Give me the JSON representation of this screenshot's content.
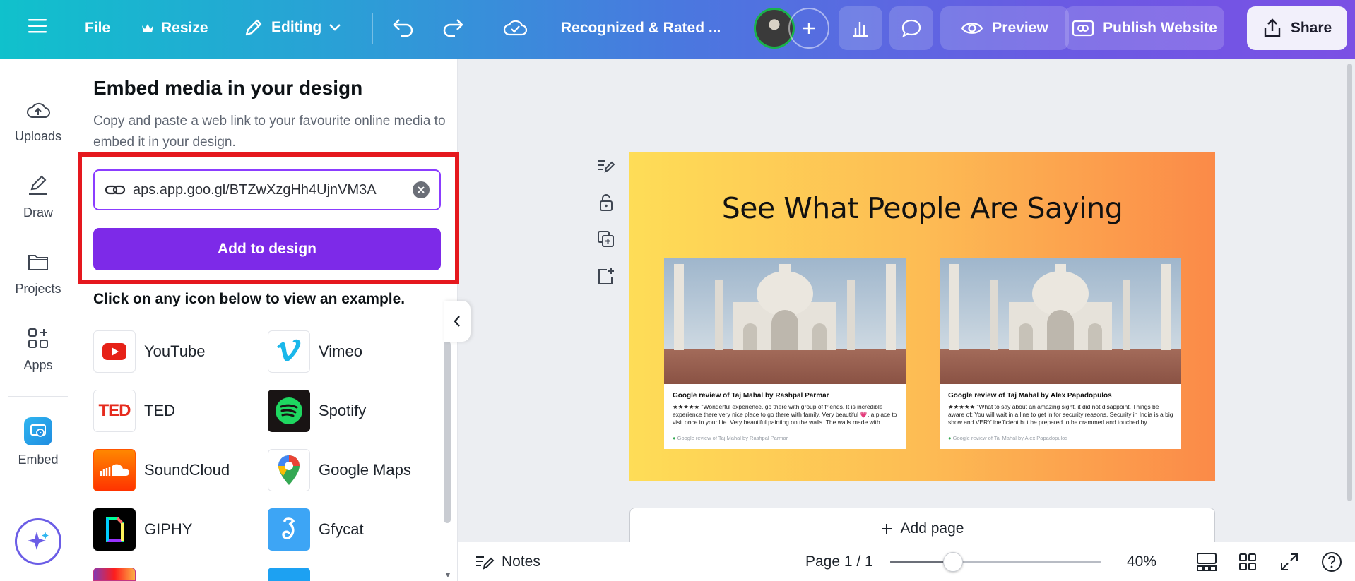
{
  "topbar": {
    "file_label": "File",
    "resize_label": "Resize",
    "editing_label": "Editing",
    "doc_title": "Recognized & Rated ...",
    "preview_label": "Preview",
    "publish_label": "Publish Website",
    "share_label": "Share",
    "gradient_colors": [
      "#10c1cc",
      "#4a78df",
      "#7b50e4"
    ]
  },
  "rail": {
    "items": [
      {
        "label": "Uploads",
        "icon": "cloud-upload-icon"
      },
      {
        "label": "Draw",
        "icon": "draw-pen-icon"
      },
      {
        "label": "Projects",
        "icon": "folder-icon"
      },
      {
        "label": "Apps",
        "icon": "apps-grid-icon"
      },
      {
        "label": "Embed",
        "icon": "embed-icon"
      }
    ]
  },
  "panel": {
    "title": "Embed media in your design",
    "description": "Copy and paste a web link to your favourite online media to embed it in your design.",
    "url_value": "aps.app.goo.gl/BTZwXzgHh4UjnVM3A",
    "add_button": "Add to design",
    "hint": "Click on any icon below to view an example.",
    "media": [
      {
        "label": "YouTube",
        "icon": "youtube-icon"
      },
      {
        "label": "Vimeo",
        "icon": "vimeo-icon"
      },
      {
        "label": "TED",
        "icon": "ted-icon"
      },
      {
        "label": "Spotify",
        "icon": "spotify-icon"
      },
      {
        "label": "SoundCloud",
        "icon": "soundcloud-icon"
      },
      {
        "label": "Google Maps",
        "icon": "google-maps-icon"
      },
      {
        "label": "GIPHY",
        "icon": "giphy-icon"
      },
      {
        "label": "Gfycat",
        "icon": "gfycat-icon"
      }
    ],
    "accent_color": "#7d2ae8",
    "highlight_color": "#e5181e"
  },
  "design": {
    "heading": "See What People Are Saying",
    "cards": [
      {
        "title": "Google review of Taj Mahal by Rashpal Parmar",
        "text": "★★★★★ \"Wonderful experience, go there with group of friends. It is incredible experience there very nice place to go there with family. Very beautiful 💗, a place to visit once in your life. Very beautiful painting on the walls. The walls made with...",
        "footer": "Google review of Taj Mahal by Rashpal Parmar"
      },
      {
        "title": "Google review of Taj Mahal by Alex Papadopulos",
        "text": "★★★★★ \"What to say about an amazing sight, it did not disappoint. Things be aware of: You will wait in a line to get in for security reasons. Security in India is a big show and VERY inefficient but be prepared to be crammed and touched by...",
        "footer": "Google review of Taj Mahal by Alex Papadopulos"
      }
    ],
    "gradient_colors": [
      "#fedd57",
      "#fb8a48"
    ],
    "add_page_label": "Add page"
  },
  "bottombar": {
    "notes_label": "Notes",
    "page_label": "Page 1 / 1",
    "zoom_label": "40%",
    "zoom_fraction": 0.3
  }
}
